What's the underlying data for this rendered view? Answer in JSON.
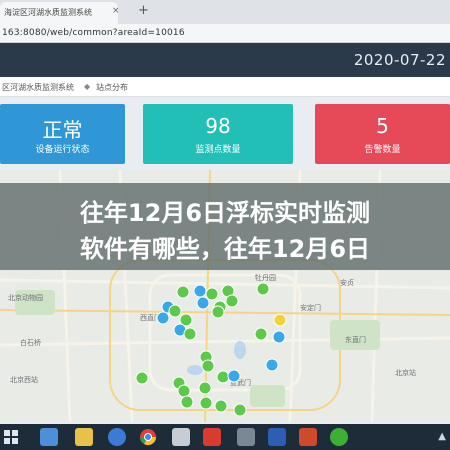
{
  "browser": {
    "tab_title": "海淀区河湖水质监测系统",
    "tab_close": "×",
    "new_tab": "+",
    "url": "163:8080/web/common?areaId=10016"
  },
  "header": {
    "date": "2020-07-22"
  },
  "breadcrumb": {
    "item1": "区河湖水质监测系统",
    "item2": "站点分布"
  },
  "cards": [
    {
      "value": "正常",
      "label": "设备运行状态",
      "color": "#2f97d6"
    },
    {
      "value": "98",
      "label": "监测点数量",
      "color": "#22bfb6"
    },
    {
      "value": "5",
      "label": "告警数量",
      "color": "#e64a58"
    }
  ],
  "map": {
    "labels": {
      "beijing_zoo": "北京动物园",
      "mudanyuan": "牡丹园",
      "anzhen": "安贞",
      "xizhimen": "西直门",
      "xuanwumen": "宣武门",
      "baishiqiao": "白石桥",
      "dongzhimen": "东直门",
      "andingmen": "安定门",
      "beijing_station": "北京站",
      "beijing_west": "北京西站"
    },
    "marker_colors": {
      "green": "#5cc94a",
      "blue": "#3aa8e8",
      "yellow": "#f2d23a"
    }
  },
  "headline": {
    "line1": "往年12月6日浮标实时监测",
    "line2": "软件有哪些，往年12月6日"
  },
  "taskbar": {
    "icons": [
      "start-icon",
      "file-explorer-icon",
      "folder-icon",
      "media-player-icon",
      "chrome-icon",
      "app-icon",
      "pdf-icon",
      "network-icon",
      "word-icon",
      "powerpoint-icon",
      "wechat-icon"
    ],
    "tray_text": "▲"
  }
}
